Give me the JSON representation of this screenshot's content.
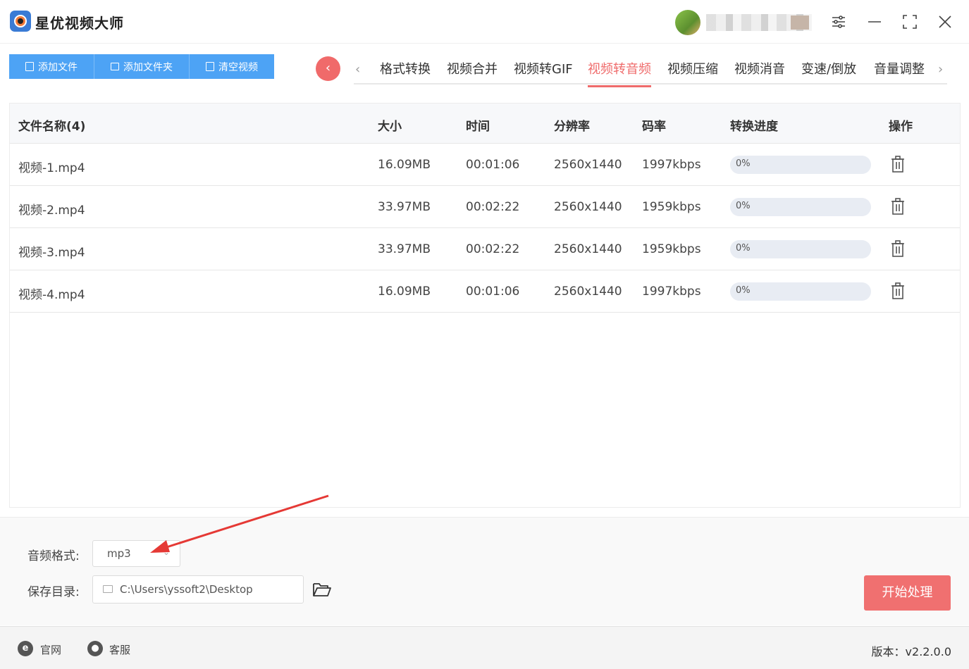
{
  "app": {
    "title": "星优视频大师"
  },
  "toolbar": {
    "add_file": "添加文件",
    "add_folder": "添加文件夹",
    "clear": "清空视频"
  },
  "tabs": [
    {
      "label": "格式转换"
    },
    {
      "label": "视频合并"
    },
    {
      "label": "视频转GIF"
    },
    {
      "label": "视频转音频",
      "active": true
    },
    {
      "label": "视频压缩"
    },
    {
      "label": "视频消音"
    },
    {
      "label": "变速/倒放"
    },
    {
      "label": "音量调整"
    }
  ],
  "table": {
    "headers": [
      "文件名称(4)",
      "大小",
      "时间",
      "分辨率",
      "码率",
      "转换进度",
      "操作"
    ],
    "rows": [
      {
        "name": "视频-1.mp4",
        "size": "16.09MB",
        "time": "00:01:06",
        "resolution": "2560x1440",
        "bitrate": "1997kbps",
        "progress": "0%"
      },
      {
        "name": "视频-2.mp4",
        "size": "33.97MB",
        "time": "00:02:22",
        "resolution": "2560x1440",
        "bitrate": "1959kbps",
        "progress": "0%"
      },
      {
        "name": "视频-3.mp4",
        "size": "33.97MB",
        "time": "00:02:22",
        "resolution": "2560x1440",
        "bitrate": "1959kbps",
        "progress": "0%"
      },
      {
        "name": "视频-4.mp4",
        "size": "16.09MB",
        "time": "00:01:06",
        "resolution": "2560x1440",
        "bitrate": "1997kbps",
        "progress": "0%"
      }
    ]
  },
  "settings": {
    "format_label": "音频格式:",
    "format_value": "mp3",
    "save_label": "保存目录:",
    "save_path": "C:\\Users\\yssoft2\\Desktop",
    "start": "开始处理"
  },
  "footer": {
    "website": "官网",
    "service": "客服",
    "version": "版本：v2.2.0.0"
  },
  "colors": {
    "accent_blue": "#4da3f5",
    "accent_red": "#ef6b6b"
  }
}
